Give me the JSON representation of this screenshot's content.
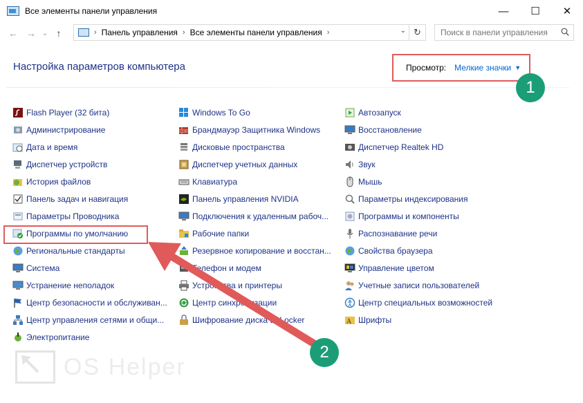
{
  "window": {
    "title": "Все элементы панели управления",
    "controls": {
      "minimize": "—",
      "maximize": "☐",
      "close": "✕"
    }
  },
  "addressbar": {
    "back": "←",
    "forward": "→",
    "recent": "⌄",
    "up": "↑",
    "crumbs": [
      "Панель управления",
      "Все элементы панели управления"
    ],
    "refresh": "↻"
  },
  "search": {
    "placeholder": "Поиск в панели управления"
  },
  "header": {
    "title": "Настройка параметров компьютера",
    "view_label": "Просмотр:",
    "view_value": "Мелкие значки"
  },
  "badges": {
    "first": "1",
    "second": "2"
  },
  "columns": [
    [
      {
        "label": "Flash Player (32 бита)",
        "icon": "flash-icon"
      },
      {
        "label": "Администрирование",
        "icon": "admin-tools-icon"
      },
      {
        "label": "Дата и время",
        "icon": "clock-icon"
      },
      {
        "label": "Диспетчер устройств",
        "icon": "device-manager-icon"
      },
      {
        "label": "История файлов",
        "icon": "file-history-icon"
      },
      {
        "label": "Панель задач и навигация",
        "icon": "taskbar-icon"
      },
      {
        "label": "Параметры Проводника",
        "icon": "folder-options-icon"
      },
      {
        "label": "Программы по умолчанию",
        "icon": "default-programs-icon"
      },
      {
        "label": "Региональные стандарты",
        "icon": "region-icon"
      },
      {
        "label": "Система",
        "icon": "system-icon"
      },
      {
        "label": "Устранение неполадок",
        "icon": "troubleshoot-icon"
      },
      {
        "label": "Центр безопасности и обслуживан...",
        "icon": "flag-icon"
      },
      {
        "label": "Центр управления сетями и общи...",
        "icon": "network-icon"
      },
      {
        "label": "Электропитание",
        "icon": "power-icon"
      }
    ],
    [
      {
        "label": "Windows To Go",
        "icon": "windows-to-go-icon"
      },
      {
        "label": "Брандмауэр Защитника Windows",
        "icon": "firewall-icon"
      },
      {
        "label": "Дисковые пространства",
        "icon": "storage-spaces-icon"
      },
      {
        "label": "Диспетчер учетных данных",
        "icon": "credential-manager-icon"
      },
      {
        "label": "Клавиатура",
        "icon": "keyboard-icon"
      },
      {
        "label": "Панель управления NVIDIA",
        "icon": "nvidia-icon"
      },
      {
        "label": "Подключения к удаленным рабоч...",
        "icon": "remote-desktop-icon"
      },
      {
        "label": "Рабочие папки",
        "icon": "work-folders-icon"
      },
      {
        "label": "Резервное копирование и восстан...",
        "icon": "backup-icon"
      },
      {
        "label": "Телефон и модем",
        "icon": "phone-modem-icon"
      },
      {
        "label": "Устройства и принтеры",
        "icon": "printer-icon"
      },
      {
        "label": "Центр синхронизации",
        "icon": "sync-center-icon"
      },
      {
        "label": "Шифрование диска BitLocker",
        "icon": "bitlocker-icon"
      }
    ],
    [
      {
        "label": "Автозапуск",
        "icon": "autoplay-icon"
      },
      {
        "label": "Восстановление",
        "icon": "recovery-icon"
      },
      {
        "label": "Диспетчер Realtek HD",
        "icon": "realtek-icon"
      },
      {
        "label": "Звук",
        "icon": "sound-icon"
      },
      {
        "label": "Мышь",
        "icon": "mouse-icon"
      },
      {
        "label": "Параметры индексирования",
        "icon": "indexing-icon"
      },
      {
        "label": "Программы и компоненты",
        "icon": "programs-features-icon"
      },
      {
        "label": "Распознавание речи",
        "icon": "microphone-icon"
      },
      {
        "label": "Свойства браузера",
        "icon": "internet-options-icon"
      },
      {
        "label": "Управление цветом",
        "icon": "color-management-icon"
      },
      {
        "label": "Учетные записи пользователей",
        "icon": "user-accounts-icon"
      },
      {
        "label": "Центр специальных возможностей",
        "icon": "ease-of-access-icon"
      },
      {
        "label": "Шрифты",
        "icon": "fonts-icon"
      }
    ]
  ],
  "watermark": {
    "text": "OS Helper"
  },
  "colors": {
    "link": "#1e3287",
    "accent": "#0066cc",
    "annotation": "#e05a5a",
    "badge": "#1b9e78"
  }
}
